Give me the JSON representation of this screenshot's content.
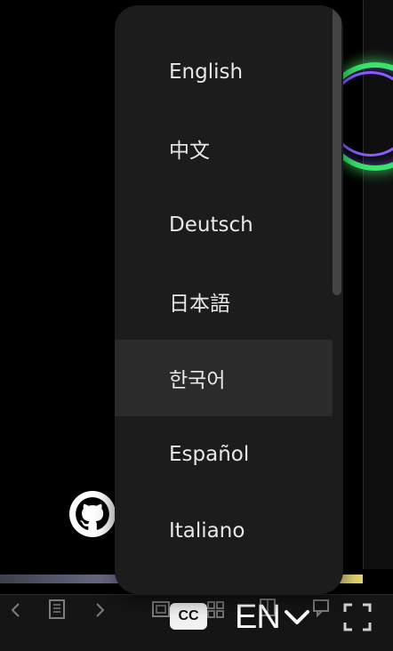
{
  "player": {
    "progress_percent": 100
  },
  "languages": {
    "options": [
      {
        "label": "English"
      },
      {
        "label": "中文"
      },
      {
        "label": "Deutsch"
      },
      {
        "label": "日本語"
      },
      {
        "label": "한국어"
      },
      {
        "label": "Español"
      },
      {
        "label": "Italiano"
      }
    ],
    "hovered_index": 4
  },
  "toolbar": {
    "cc_label": "CC",
    "current_language": "EN"
  },
  "icons": {
    "prev": "chevron-left-icon",
    "pages": "document-icon",
    "next": "chevron-right-icon",
    "layout_single": "single-page-icon",
    "layout_grid": "grid-icon",
    "book": "book-icon",
    "comment": "comment-icon",
    "fullscreen": "fullscreen-icon",
    "github": "github-icon"
  },
  "colors": {
    "dropdown_bg": "#1c1c1c",
    "hover_bg": "#2b2b2b",
    "accent_green": "#39e36c"
  }
}
